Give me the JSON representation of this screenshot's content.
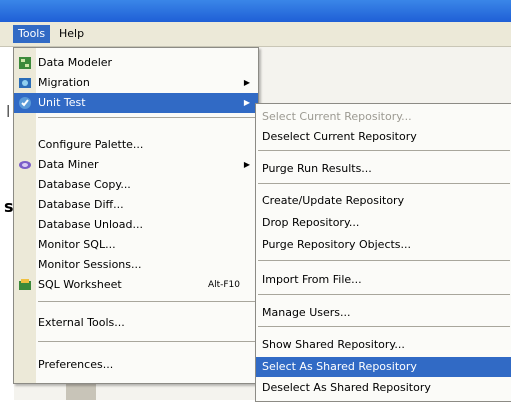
{
  "menubar": {
    "tools": "Tools",
    "help": "Help"
  },
  "left_edge": {
    "char1": "s",
    "char2": "l"
  },
  "tools_menu": {
    "data_modeler": "Data Modeler",
    "migration": "Migration",
    "unit_test": "Unit Test",
    "configure_palette": "Configure Palette...",
    "data_miner": "Data Miner",
    "database_copy": "Database Copy...",
    "database_diff": "Database Diff...",
    "database_unload": "Database Unload...",
    "monitor_sql": "Monitor SQL...",
    "monitor_sessions": "Monitor Sessions...",
    "sql_worksheet": "SQL Worksheet",
    "sql_worksheet_shortcut": "Alt-F10",
    "external_tools": "External Tools...",
    "preferences": "Preferences..."
  },
  "unit_test_menu": {
    "select_current_repository": "Select Current Repository...",
    "deselect_current_repository": "Deselect Current Repository",
    "purge_run_results": "Purge Run Results...",
    "create_update_repository": "Create/Update Repository",
    "drop_repository": "Drop Repository...",
    "purge_repository_objects": "Purge Repository Objects...",
    "import_from_file": "Import From File...",
    "manage_users": "Manage Users...",
    "show_shared_repository": "Show Shared Repository...",
    "select_as_shared_repository": "Select As Shared Repository",
    "deselect_as_shared_repository": "Deselect As Shared Repository"
  },
  "colors": {
    "highlight": "#316ac5",
    "menu_bg": "#fbfbf8",
    "menubar_bg": "#ece9d8",
    "titlebar": "#2b72e0",
    "disabled_text": "#9c9a92"
  },
  "icons": {
    "data_modeler": "data-modeler-icon",
    "migration": "migration-icon",
    "unit_test": "unit-test-icon",
    "data_miner": "data-miner-icon",
    "sql_worksheet": "sql-worksheet-icon",
    "submenu_arrow": "submenu-arrow-icon"
  }
}
